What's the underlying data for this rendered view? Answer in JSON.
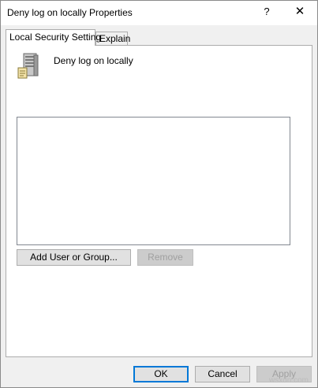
{
  "window": {
    "title": "Deny log on locally Properties",
    "help_glyph": "?",
    "close_glyph": "✕"
  },
  "tabs": [
    {
      "label": "Local Security Setting",
      "active": true
    },
    {
      "label": "Explain",
      "active": false
    }
  ],
  "policy": {
    "icon": "server-policy-icon",
    "name": "Deny log on locally"
  },
  "user_list": {
    "items": []
  },
  "buttons": {
    "add_label": "Add User or Group...",
    "remove_label": "Remove",
    "ok_label": "OK",
    "cancel_label": "Cancel",
    "apply_label": "Apply"
  },
  "watermark": "wsxdn.com",
  "colors": {
    "accent": "#0078d7",
    "dialog_bg": "#f0f0f0",
    "panel_bg": "#ffffff",
    "disabled_text": "#a0a0a0"
  }
}
